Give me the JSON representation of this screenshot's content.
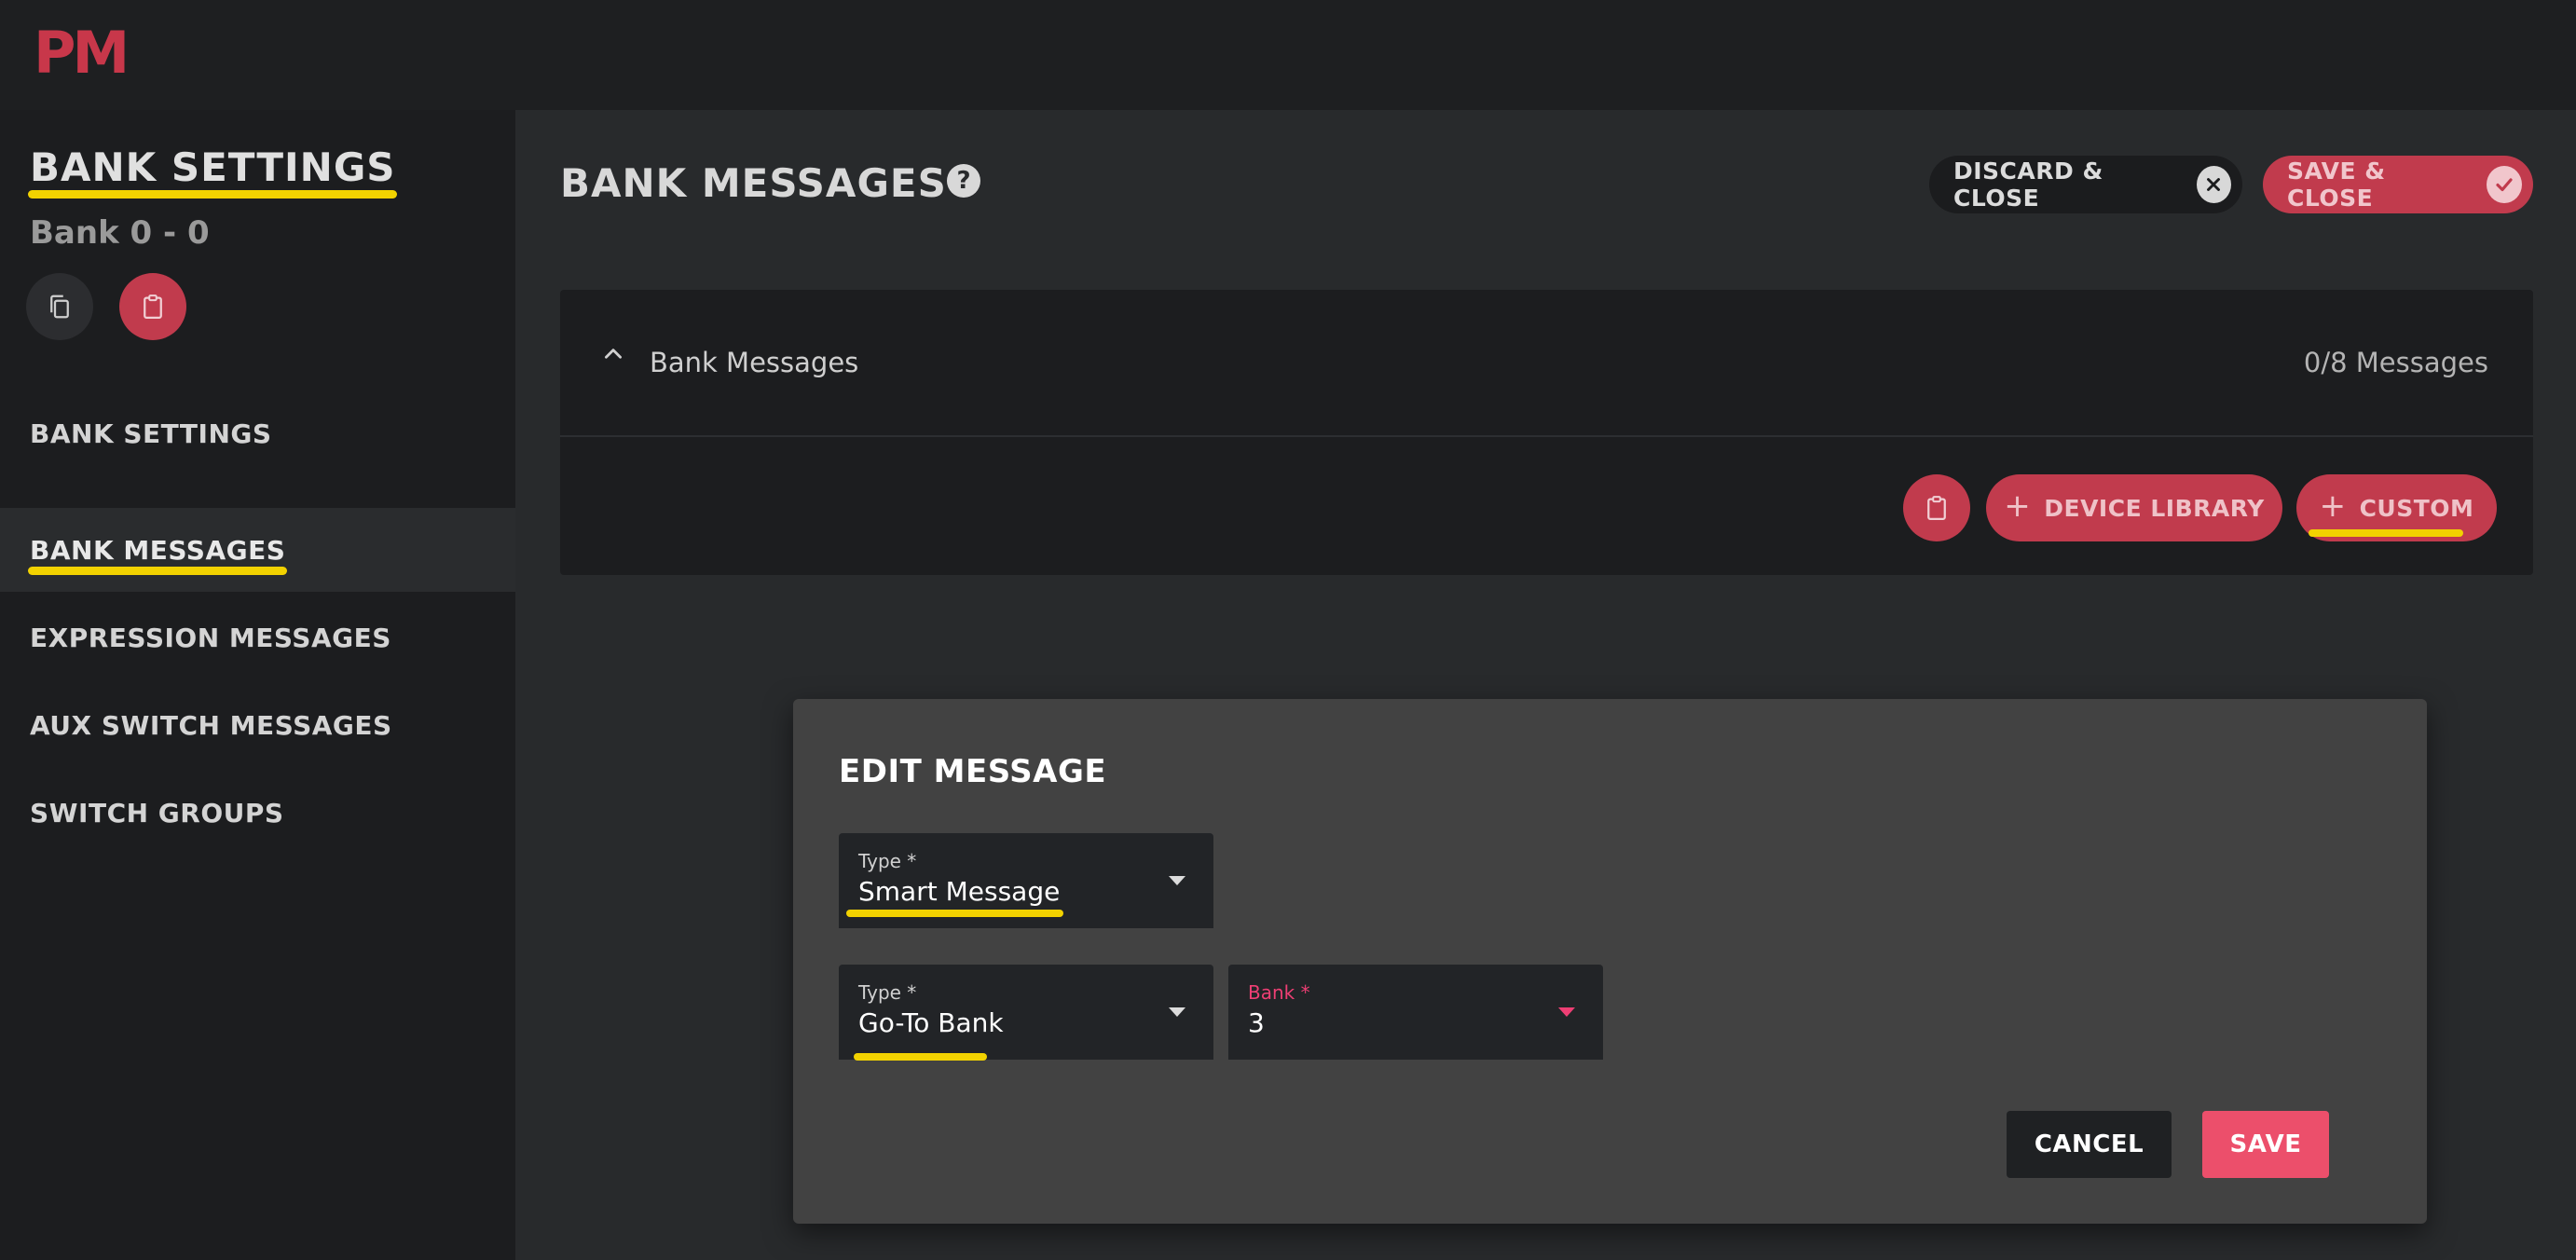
{
  "app": {
    "logo_text": "PM",
    "accent_color": "#c13b4d",
    "highlight_color": "#f2d200"
  },
  "sidebar": {
    "title": "BANK SETTINGS",
    "subtitle": "Bank 0 - 0",
    "icons": {
      "copy": "copy-icon",
      "paste": "clipboard-icon"
    },
    "items": [
      {
        "label": "BANK SETTINGS",
        "active": false
      },
      {
        "label": "BANK MESSAGES",
        "active": true
      },
      {
        "label": "EXPRESSION MESSAGES",
        "active": false
      },
      {
        "label": "AUX SWITCH MESSAGES",
        "active": false
      },
      {
        "label": "SWITCH GROUPS",
        "active": false
      }
    ]
  },
  "main": {
    "title": "BANK MESSAGES",
    "help_icon": "?",
    "discard_label": "DISCARD & CLOSE",
    "save_close_label": "SAVE & CLOSE"
  },
  "panel": {
    "title": "Bank Messages",
    "count": "0/8 Messages",
    "device_library_label": "DEVICE LIBRARY",
    "custom_label": "CUSTOM",
    "plus": "+"
  },
  "dialog": {
    "title": "EDIT MESSAGE",
    "type_field": {
      "label": "Type *",
      "value": "Smart Message"
    },
    "subtype_field": {
      "label": "Type *",
      "value": "Go-To Bank"
    },
    "bank_field": {
      "label": "Bank *",
      "value": "3"
    },
    "cancel_label": "CANCEL",
    "save_label": "SAVE"
  }
}
